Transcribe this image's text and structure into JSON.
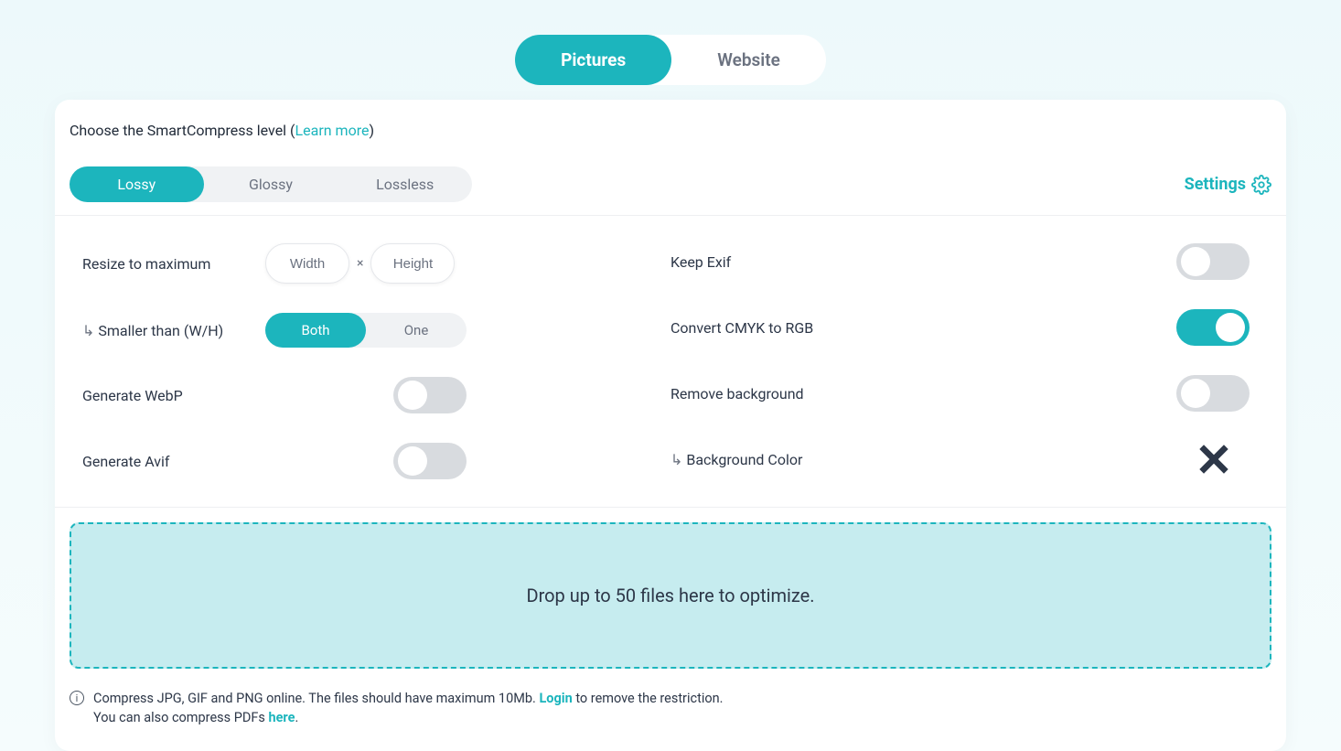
{
  "tabs": {
    "pictures": "Pictures",
    "website": "Website"
  },
  "header": {
    "prompt_pre": "Choose the SmartCompress level (",
    "learn_more": "Learn more",
    "prompt_post": ")"
  },
  "levels": {
    "lossy": "Lossy",
    "glossy": "Glossy",
    "lossless": "Lossless"
  },
  "settings_label": "Settings",
  "left": {
    "resize": "Resize to maximum",
    "width_ph": "Width",
    "height_ph": "Height",
    "times": "×",
    "smaller": "Smaller than (W/H)",
    "both": "Both",
    "one": "One",
    "webp": "Generate WebP",
    "avif": "Generate Avif"
  },
  "right": {
    "exif": "Keep Exif",
    "cmyk": "Convert CMYK to RGB",
    "removebg": "Remove background",
    "bgcolor": "Background Color"
  },
  "dropzone": "Drop up to 50 files here to optimize.",
  "footer": {
    "line1_pre": "Compress JPG, GIF and PNG online. The files should have maximum 10Mb. ",
    "login": "Login",
    "line1_post": " to remove the restriction.",
    "line2_pre": "You can also compress PDFs ",
    "here": "here",
    "line2_post": "."
  }
}
